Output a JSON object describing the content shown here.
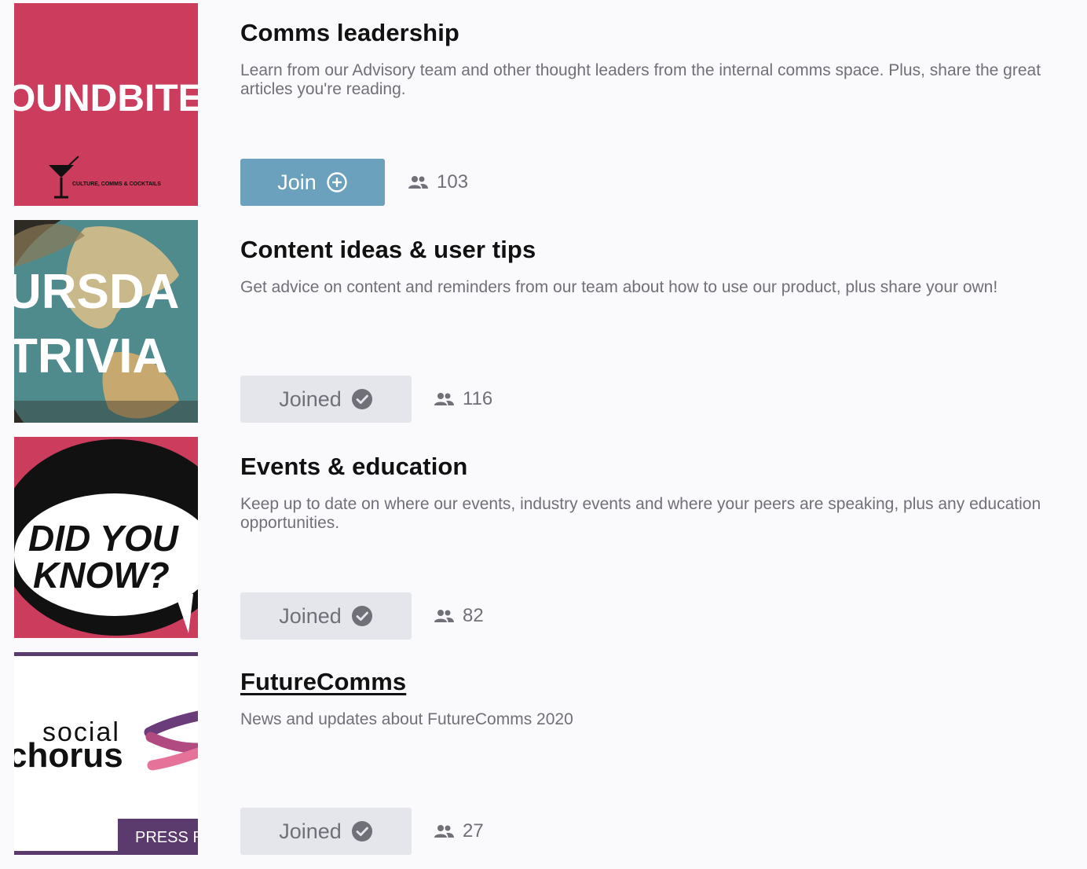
{
  "channels": [
    {
      "title": "Comms leadership",
      "description": "Learn from our Advisory team and other thought leaders from the internal comms space. Plus, share the great articles you're reading.",
      "button_label": "Join",
      "member_count": "103",
      "thumb": {
        "big_text": "OUNDBITE",
        "tagline": "CULTURE, COMMS & COCKTAILS",
        "bg": "#cc3c5c"
      }
    },
    {
      "title": "Content ideas & user tips",
      "description": "Get advice on content and reminders from our team about how to use our product, plus share your own!",
      "button_label": "Joined",
      "member_count": "116",
      "thumb": {
        "line1": "URSDA",
        "line2": "TRIVIA"
      }
    },
    {
      "title": "Events & education",
      "description": "Keep up to date on where our events, industry events and where your peers are speaking, plus any education opportunities.",
      "button_label": "Joined",
      "member_count": "82",
      "thumb": {
        "line1": "DID YOU",
        "line2": "KNOW?",
        "bg": "#cc3c5c"
      }
    },
    {
      "title": "FutureComms",
      "description": "News and updates about FutureComms 2020",
      "button_label": "Joined",
      "member_count": "27",
      "thumb": {
        "logo_top": "social",
        "logo_bottom": "chorus",
        "badge": "PRESS R"
      }
    }
  ],
  "colors": {
    "join_button": "#6ba1bd",
    "joined_button": "#e5e5ec",
    "muted_text": "#707078",
    "brand_pink": "#cc3c5c",
    "brand_purple": "#5b3a6e"
  },
  "icons": {
    "join": "plus-circle-icon",
    "joined": "check-circle-icon",
    "members": "people-icon"
  }
}
